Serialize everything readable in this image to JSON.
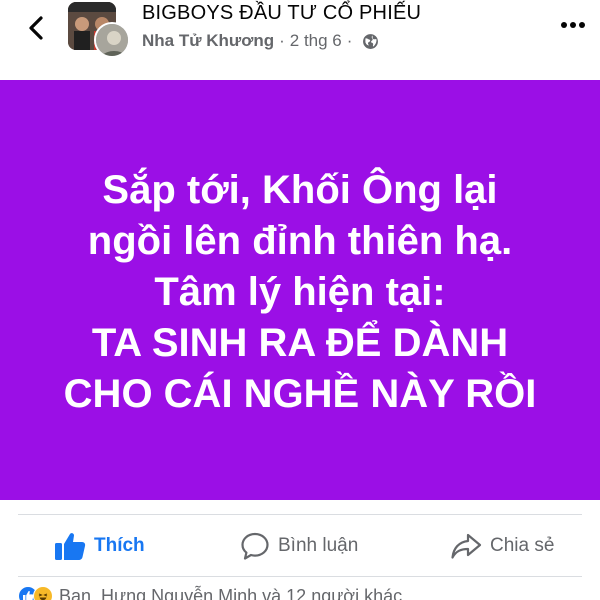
{
  "header": {
    "group_name": "BIGBOYS ĐẦU TƯ CỔ PHIẾU",
    "author": "Nha Tử Khương",
    "separator": "·",
    "date": "2 thg 6",
    "back_icon": "chevron-left-icon",
    "more_icon": "more-horizontal-icon",
    "privacy_icon": "globe-icon"
  },
  "post": {
    "background_color": "#9b0fe6",
    "text_color": "#ffffff",
    "lines": [
      "Sắp tới, Khối Ông lại",
      "ngồi lên đỉnh thiên hạ.",
      "Tâm lý hiện tại:",
      "TA SINH RA ĐỂ DÀNH",
      "CHO CÁI NGHỀ NÀY RỒI"
    ]
  },
  "actions": {
    "like_label": "Thích",
    "comment_label": "Bình luận",
    "share_label": "Chia sẻ",
    "like_color": "#1877f2",
    "muted_color": "#65676b"
  },
  "reactions": {
    "summary": "Bạn, Hưng Nguyễn Minh và 12 người khác"
  }
}
